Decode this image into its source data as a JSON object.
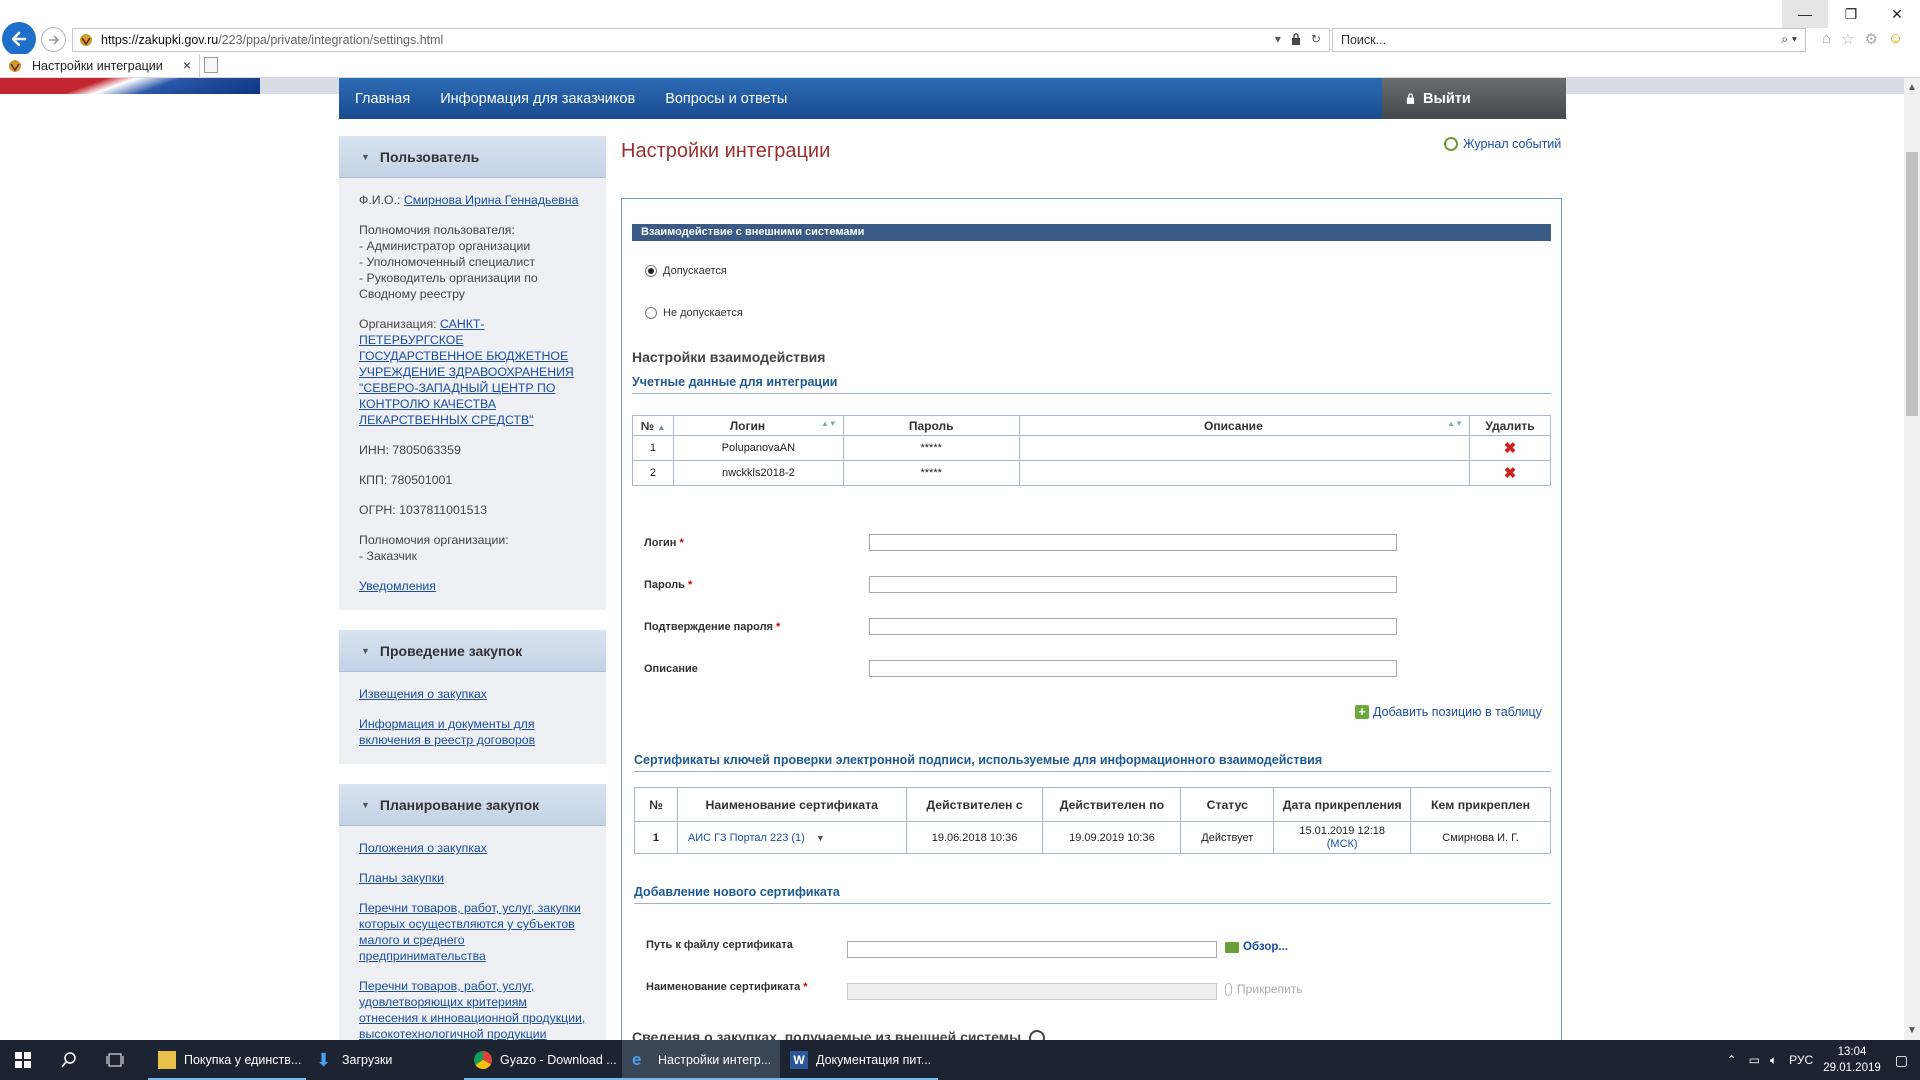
{
  "browser": {
    "url_host": "https://zakupki.gov.ru",
    "url_path": "/223/ppa/private/integration/settings.html",
    "search_placeholder": "Поиск...",
    "tab_title": "Настройки интеграции"
  },
  "nav": {
    "items": [
      "Главная",
      "Информация для заказчиков",
      "Вопросы и ответы"
    ],
    "logout": "Выйти"
  },
  "sidebar": {
    "user": {
      "title": "Пользователь",
      "fio_label": "Ф.И.О.:",
      "fio_value": "Смирнова Ирина Геннадьевна",
      "perm_title": "Полномочия пользователя:",
      "perms": [
        "- Администратор организации",
        "- Уполномоченный специалист",
        "- Руководитель организации по Сводному реестру"
      ],
      "org_label": "Организация:",
      "org_value": "САНКТ-ПЕТЕРБУРГСКОЕ ГОСУДАРСТВЕННОЕ БЮДЖЕТНОЕ УЧРЕЖДЕНИЕ ЗДРАВООХРАНЕНИЯ \"СЕВЕРО-ЗАПАДНЫЙ ЦЕНТР ПО КОНТРОЛЮ КАЧЕСТВА ЛЕКАРСТВЕННЫХ СРЕДСТВ\"",
      "inn": "ИНН: 7805063359",
      "kpp": "КПП: 780501001",
      "ogrn": "ОГРН: 1037811001513",
      "org_perm_title": "Полномочия организации:",
      "org_perm": "- Заказчик",
      "notifications": "Уведомления"
    },
    "procurement": {
      "title": "Проведение закупок",
      "links": [
        "Извещения о закупках",
        "Информация и документы для включения в реестр договоров"
      ]
    },
    "planning": {
      "title": "Планирование закупок",
      "links": [
        "Положения о закупках",
        "Планы закупки",
        "Перечни товаров, работ, услуг, закупки которых осуществляются у субъектов малого и среднего предпринимательства",
        "Перечни товаров, работ, услуг, удовлетворяющих критериям отнесения к инновационной продукции, высокотехнологичной продукции"
      ]
    }
  },
  "main": {
    "title": "Настройки интеграции",
    "journal": "Журнал событий",
    "interaction_bar": "Взаимодействие с внешними системами",
    "radio_allowed": "Допускается",
    "radio_denied": "Не допускается",
    "settings_title": "Настройки взаимодействия",
    "creds_title": "Учетные данные для интеграции",
    "creds_headers": [
      "№",
      "Логин",
      "Пароль",
      "Описание",
      "Удалить"
    ],
    "creds_rows": [
      {
        "n": "1",
        "login": "PolupanovaAN",
        "password": "*****",
        "desc": ""
      },
      {
        "n": "2",
        "login": "nwckkls2018-2",
        "password": "*****",
        "desc": ""
      }
    ],
    "form": {
      "login": "Логин",
      "password": "Пароль",
      "confirm": "Подтверждение пароля",
      "desc": "Описание",
      "required_mark": "*"
    },
    "add_position": "Добавить позицию в таблицу",
    "certs_title": "Сертификаты ключей проверки электронной подписи, используемые для информационного взаимодействия",
    "certs_headers": [
      "№",
      "Наименование сертификата",
      "Действителен с",
      "Действителен по",
      "Статус",
      "Дата прикрепления",
      "Кем прикреплен"
    ],
    "certs_rows": [
      {
        "n": "1",
        "name": "АИС ГЗ Портал 223 (1)",
        "from": "19.06.2018 10:36",
        "to": "19.09.2019 10:36",
        "status": "Действует",
        "attached": "15.01.2019 12:18",
        "tz": "(МСК)",
        "by": "Смирнова И. Г."
      }
    ],
    "new_cert_title": "Добавление нового сертификата",
    "cert_path_label": "Путь к файлу сертификата",
    "browse": "Обзор...",
    "cert_name_label": "Наименование сертификата",
    "attach": "Прикрепить",
    "bottom_section": "Сведения о закупках, получаемые из внешней системы"
  },
  "taskbar": {
    "apps": [
      "Покупка у единств...",
      "Загрузки",
      "Gyazo - Download ...",
      "Настройки интегр...",
      "Документация пит..."
    ],
    "lang": "РУС",
    "time": "13:04",
    "date": "29.01.2019"
  }
}
